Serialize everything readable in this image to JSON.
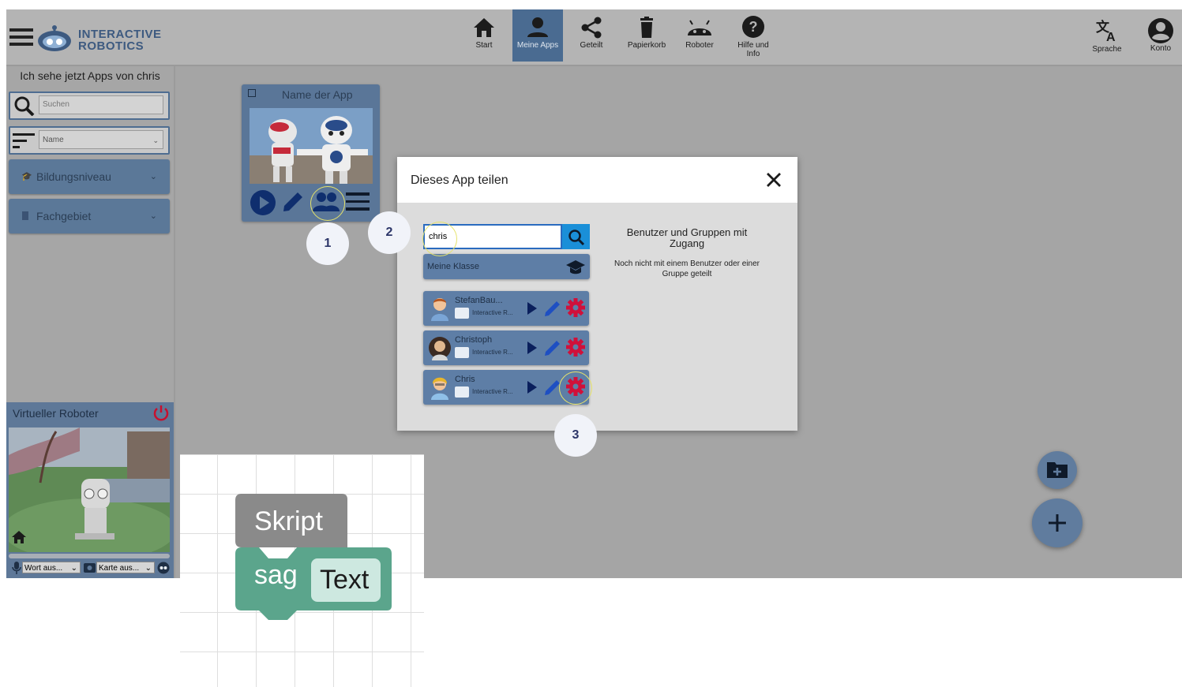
{
  "header": {
    "logo_line1": "INTERACTIVE",
    "logo_line2": "ROBOTICS",
    "nav": [
      {
        "label": "Start",
        "icon": "home-icon"
      },
      {
        "label": "Meine Apps",
        "icon": "person-icon",
        "active": true
      },
      {
        "label": "Geteilt",
        "icon": "share-icon"
      },
      {
        "label": "Papierkorb",
        "icon": "trash-icon"
      },
      {
        "label": "Roboter",
        "icon": "android-icon"
      },
      {
        "label": "Hilfe und Info",
        "icon": "help-icon"
      }
    ],
    "right": [
      {
        "label": "Sprache",
        "icon": "translate-icon"
      },
      {
        "label": "Konto",
        "icon": "account-icon"
      }
    ]
  },
  "sidebar": {
    "viewing_text": "Ich sehe jetzt Apps von chris",
    "search_placeholder": "Suchen",
    "sort_value": "Name",
    "filters": [
      {
        "label": "Bildungsniveau"
      },
      {
        "label": "Fachgebiet"
      }
    ]
  },
  "app_card": {
    "title": "Name der App"
  },
  "virtual_robot": {
    "title": "Virtueller Roboter",
    "word_select": "Wort aus...",
    "map_select": "Karte aus..."
  },
  "share_dialog": {
    "title": "Dieses App teilen",
    "search_value": "chris",
    "class_label": "Meine Klasse",
    "users": [
      {
        "name": "StefanBau...",
        "org": "Interactive R..."
      },
      {
        "name": "Christoph",
        "org": "Interactive R..."
      },
      {
        "name": "Chris",
        "org": "Interactive R..."
      }
    ],
    "access_title": "Benutzer und Gruppen mit Zugang",
    "access_empty": "Noch nicht mit einem Benutzer oder einer Gruppe geteilt"
  },
  "steps": [
    "1",
    "2",
    "3"
  ],
  "blocks": {
    "script_label": "Skript",
    "say_label": "sag",
    "text_label": "Text"
  },
  "colors": {
    "accent": "#4a6b91",
    "block_green": "#5ba58c",
    "block_gray": "#8a8a8a",
    "gear_red": "#d0103a"
  }
}
